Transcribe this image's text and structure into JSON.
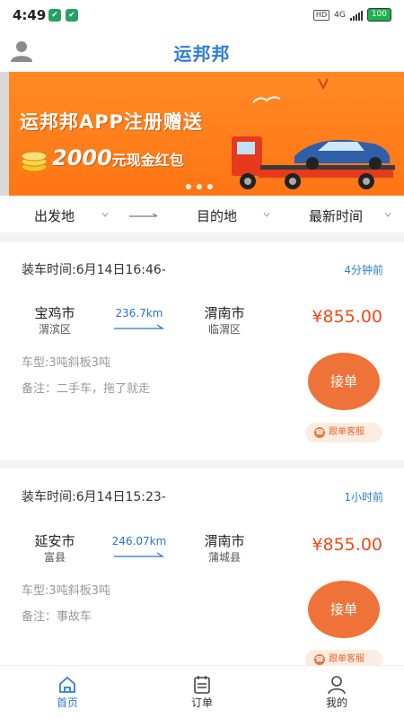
{
  "status_bar": {
    "time": "4:49",
    "hd": "HD",
    "network": "4G",
    "battery": "100"
  },
  "app": {
    "title": "运邦邦"
  },
  "banner": {
    "line1": "运邦邦APP注册赠送",
    "line2_amount": "2000",
    "line2_text": "元现金红包",
    "slides": 3,
    "colors": {
      "background": "#ff7b18",
      "truck": "#e53a1e",
      "car": "#2f5fa8"
    }
  },
  "filters": {
    "origin": "出发地",
    "destination": "目的地",
    "sort": "最新时间"
  },
  "orders": [
    {
      "load_time": "装车时间:6月14日16:46-",
      "ago": "4分钟前",
      "from_city": "宝鸡市",
      "from_district": "渭滨区",
      "distance": "236.7km",
      "to_city": "渭南市",
      "to_district": "临渭区",
      "price": "¥855.00",
      "vehicle": "车型:3吨斜板3吨",
      "note": "备注：二手车，拖了就走",
      "accept_label": "接单",
      "service_label": "跟单客服"
    },
    {
      "load_time": "装车时间:6月14日15:23-",
      "ago": "1小时前",
      "from_city": "延安市",
      "from_district": "富县",
      "distance": "246.07km",
      "to_city": "渭南市",
      "to_district": "蒲城县",
      "price": "¥855.00",
      "vehicle": "车型:3吨斜板3吨",
      "note": "备注：事故车",
      "accept_label": "接单",
      "service_label": "跟单客服"
    }
  ],
  "bottom_nav": {
    "items": [
      {
        "label": "首页",
        "icon": "home-icon",
        "active": true
      },
      {
        "label": "订单",
        "icon": "orders-icon",
        "active": false
      },
      {
        "label": "我的",
        "icon": "profile-icon",
        "active": false
      }
    ]
  },
  "colors": {
    "accent_blue": "#2f7fd6",
    "price_red": "#ee4b1d",
    "accept_orange": "#ef7338"
  }
}
